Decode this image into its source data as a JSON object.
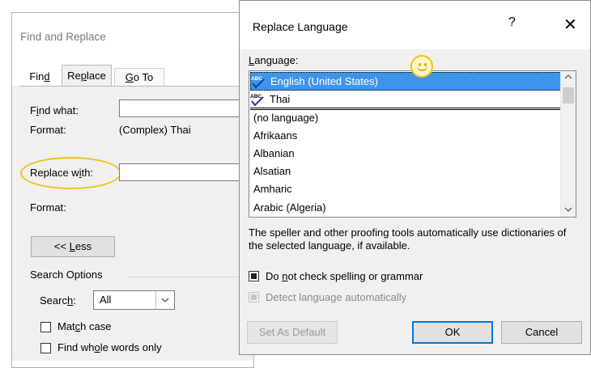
{
  "find_replace": {
    "title": "Find and Replace",
    "tabs": [
      "Find",
      "Replace",
      "Go To"
    ],
    "find_what_label": "Find what:",
    "format_label": "Format:",
    "format_value": "(Complex) Thai",
    "replace_with_label": "Replace with:",
    "format2_label": "Format:",
    "less_button": "<< Less",
    "search_options_label": "Search Options",
    "search_label": "Search:",
    "search_value": "All",
    "match_case_label": "Match case",
    "whole_words_label": "Find whole words only"
  },
  "replace_language": {
    "title": "Replace Language",
    "help": "?",
    "close": "✕",
    "language_label": "Language:",
    "languages": [
      "English (United States)",
      "Thai",
      "(no language)",
      "Afrikaans",
      "Albanian",
      "Alsatian",
      "Amharic",
      "Arabic (Algeria)"
    ],
    "selected_index": 0,
    "note": "The speller and other proofing tools automatically use dictionaries of the selected language, if available.",
    "no_check_label": "Do not check spelling or grammar",
    "no_check_checked": true,
    "detect_label": "Detect language automatically",
    "set_default_button": "Set As Default",
    "ok_button": "OK",
    "cancel_button": "Cancel"
  },
  "colors": {
    "selection": "#3f94e8",
    "highlight": "#f2c21a",
    "ok_border": "#0078d7"
  },
  "icons": [
    "spelling-check-icon",
    "smiley-icon",
    "close-icon",
    "help-icon",
    "chevron-down-icon",
    "scroll-up-icon",
    "scroll-down-icon"
  ]
}
